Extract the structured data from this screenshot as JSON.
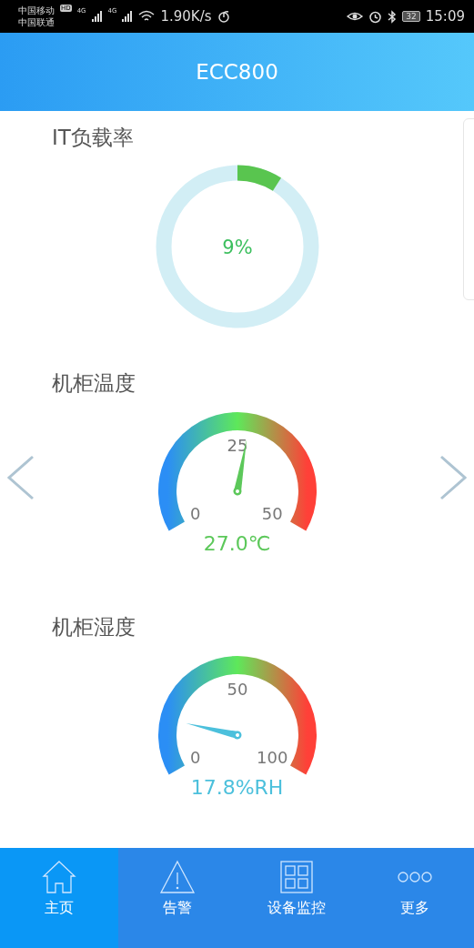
{
  "status_bar": {
    "carrier_1": "中国移动",
    "carrier_2": "中国联通",
    "hd": "HD",
    "network_1": "4G",
    "network_2": "4G",
    "speed": "1.90K/s",
    "battery": "32",
    "time": "15:09"
  },
  "header": {
    "title": "ECC800"
  },
  "it_load": {
    "title": "IT负载率",
    "level": 0.09,
    "reading": "9%"
  },
  "gauges": [
    {
      "title": "机柜温度",
      "ticks": [
        "0",
        "25",
        "50"
      ],
      "reading": "27.0℃",
      "color": "#5cc85a"
    },
    {
      "title": "机柜湿度",
      "ticks": [
        "0",
        "50",
        "100"
      ],
      "reading": "17.8%RH",
      "color": "#4cc0dc"
    }
  ],
  "nav": [
    {
      "label": "主页",
      "kind": "home",
      "selected": true
    },
    {
      "label": "告警",
      "kind": "alarm",
      "selected": false
    },
    {
      "label": "设备监控",
      "kind": "grid",
      "selected": false
    },
    {
      "label": "更多",
      "kind": "more",
      "selected": false
    }
  ]
}
